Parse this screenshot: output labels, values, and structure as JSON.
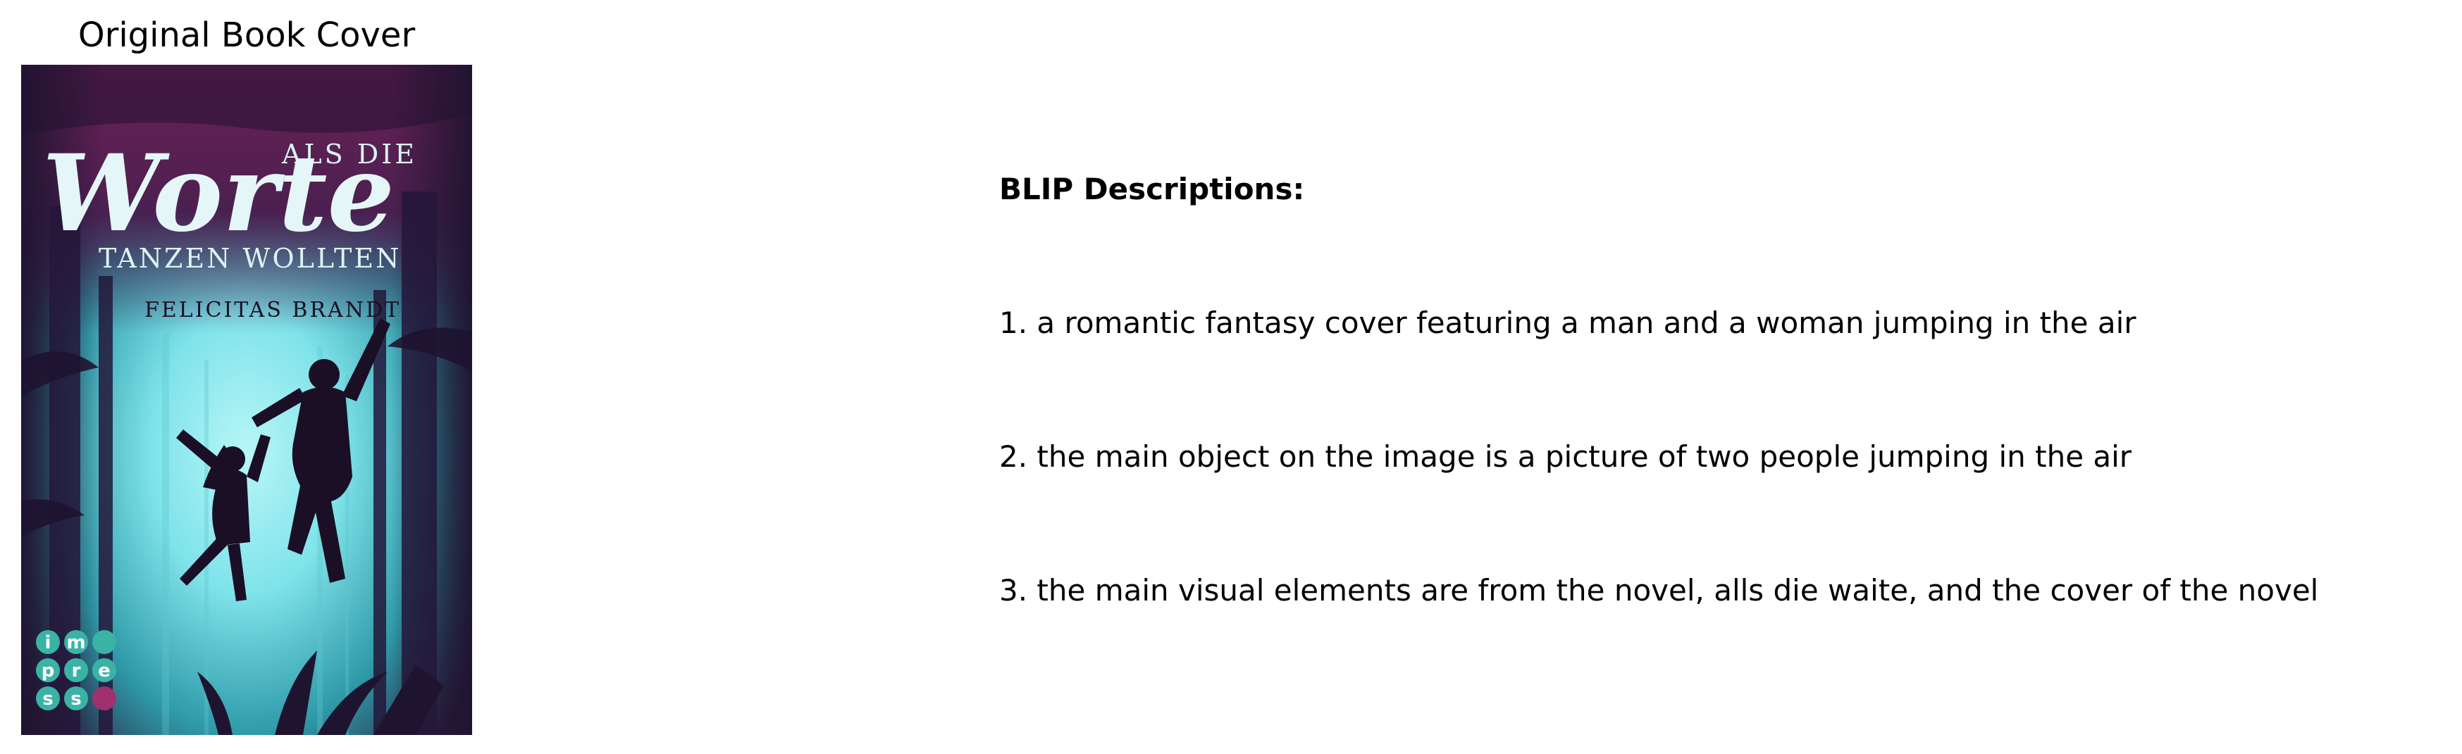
{
  "figure": {
    "cover_title": "Original Book Cover",
    "cover": {
      "title_small_top": "ALS DIE",
      "title_large": "Worte",
      "title_bottom": "TANZEN WOLLTEN",
      "author": "FELICITAS BRANDT",
      "publisher_logo": "impress",
      "colors": {
        "dark_purple": "#3a1a3e",
        "magenta": "#6e1f55",
        "cyan_glow": "#7fe3ea",
        "teal": "#2e9aa8",
        "silhouette": "#1a0f24",
        "logo_teal": "#39b3a6",
        "logo_magenta": "#a0306f"
      }
    },
    "descriptions": {
      "heading": "BLIP Descriptions:",
      "items": [
        "1. a romantic fantasy cover featuring a man and a woman jumping in the air",
        "2. the main object on the image is a picture of two people jumping in the air",
        "3. the main visual elements are from the novel, alls die waite, and the cover of the novel"
      ]
    }
  }
}
